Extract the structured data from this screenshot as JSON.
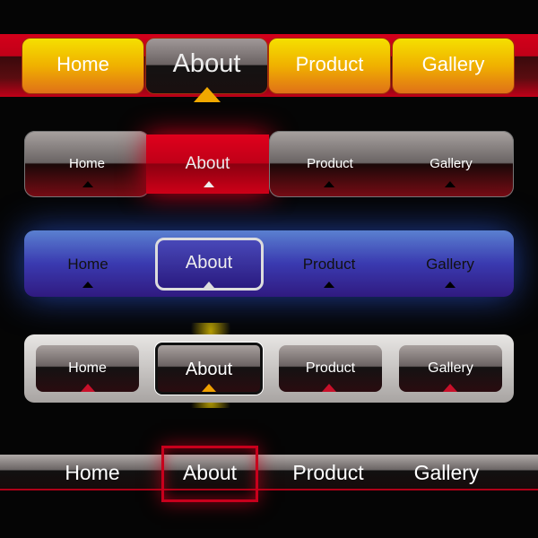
{
  "menus": [
    {
      "style": "orange-red",
      "selected": "About",
      "items": [
        {
          "label": "Home"
        },
        {
          "label": "About"
        },
        {
          "label": "Product"
        },
        {
          "label": "Gallery"
        }
      ]
    },
    {
      "style": "grey-red",
      "selected": "About",
      "items": [
        {
          "label": "Home"
        },
        {
          "label": "About"
        },
        {
          "label": "Product"
        },
        {
          "label": "Gallery"
        }
      ]
    },
    {
      "style": "blue",
      "selected": "About",
      "items": [
        {
          "label": "Home"
        },
        {
          "label": "About"
        },
        {
          "label": "Product"
        },
        {
          "label": "Gallery"
        }
      ]
    },
    {
      "style": "silver",
      "selected": "About",
      "items": [
        {
          "label": "Home"
        },
        {
          "label": "About"
        },
        {
          "label": "Product"
        },
        {
          "label": "Gallery"
        }
      ]
    },
    {
      "style": "flat-band",
      "selected": "About",
      "items": [
        {
          "label": "Home"
        },
        {
          "label": "About"
        },
        {
          "label": "Product"
        },
        {
          "label": "Gallery"
        }
      ]
    }
  ],
  "colors": {
    "accent_red": "#d0001c",
    "accent_orange": "#f0b000",
    "accent_blue": "#3a3ab0",
    "background": "#050505"
  }
}
